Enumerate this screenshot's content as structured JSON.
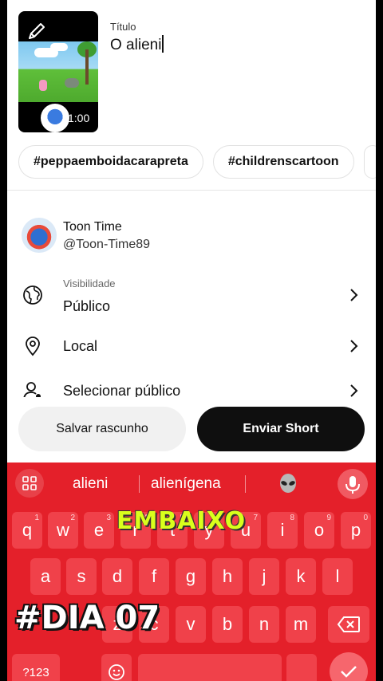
{
  "upload": {
    "duration": "1:00",
    "title_label": "Título",
    "title_value": "O alieni"
  },
  "hashtags": [
    "#peppaemboidacarapreta",
    "#childrenscartoon"
  ],
  "channel": {
    "name": "Toon Time",
    "handle": "@Toon-Time89"
  },
  "settings": {
    "visibility_label": "Visibilidade",
    "visibility_value": "Público",
    "location": "Local",
    "audience": "Selecionar público"
  },
  "actions": {
    "save_draft": "Salvar rascunho",
    "send_short": "Enviar Short"
  },
  "keyboard": {
    "suggestions": [
      "alieni",
      "alienígena"
    ],
    "row1": [
      "q",
      "w",
      "e",
      "r",
      "t",
      "y",
      "u",
      "i",
      "o",
      "p"
    ],
    "row1_hints": [
      "1",
      "2",
      "3",
      "4",
      "5",
      "6",
      "7",
      "8",
      "9",
      "0"
    ],
    "row2": [
      "a",
      "s",
      "d",
      "f",
      "g",
      "h",
      "j",
      "k",
      "l"
    ],
    "row3": [
      "z",
      "x",
      "c",
      "v",
      "b",
      "n",
      "m"
    ],
    "symbols_key": "?123",
    "accent_color": "#e4202a"
  },
  "overlay": {
    "top_caption": "EMBAIXO",
    "bottom_caption": "#DIA 07"
  }
}
